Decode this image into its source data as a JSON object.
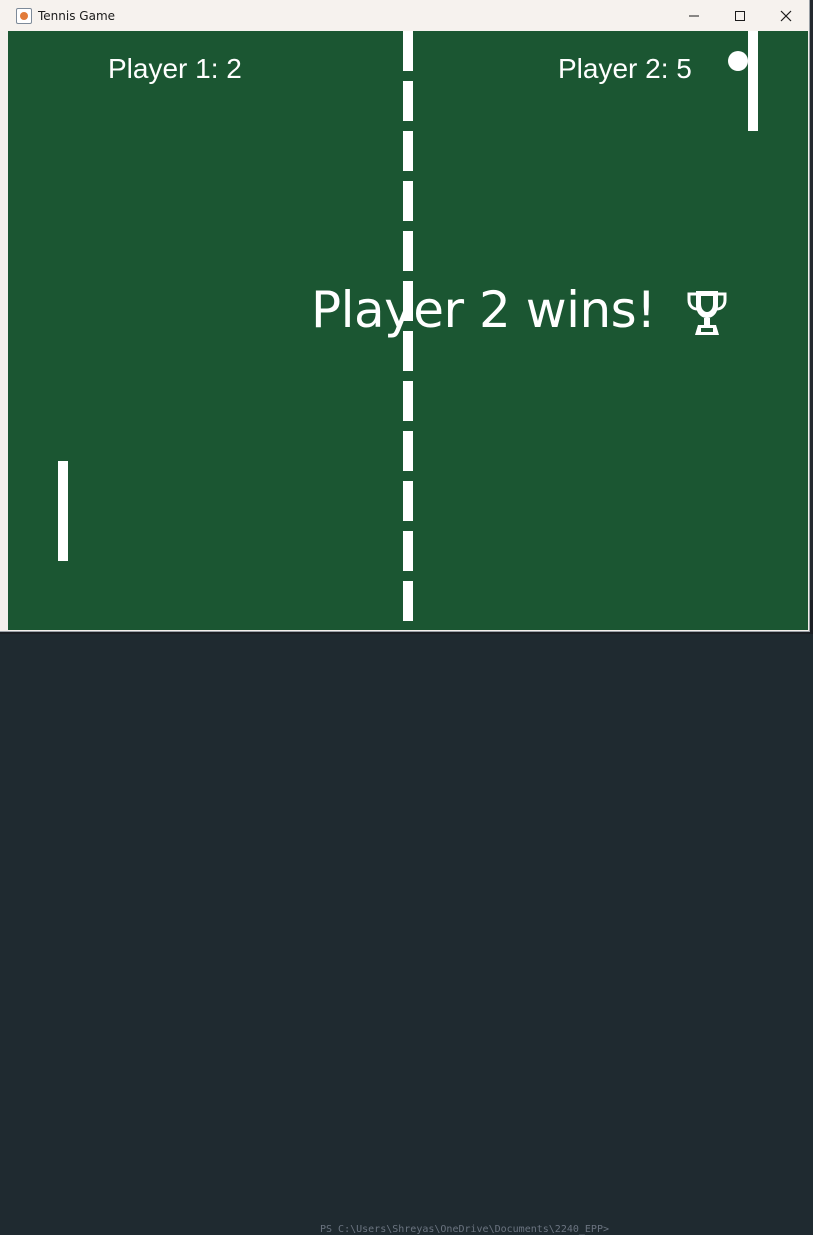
{
  "window": {
    "title": "Tennis Game",
    "icon": "java-app-icon",
    "controls": [
      "minimize-icon",
      "maximize-icon",
      "close-icon"
    ]
  },
  "game": {
    "player1_score_text": "Player 1: 2",
    "player2_score_text": "Player 2: 5",
    "winner_text": "Player 2 wins!",
    "winner_icon": "trophy-icon",
    "player1": {
      "name": "Player 1",
      "score": 2
    },
    "player2": {
      "name": "Player 2",
      "score": 5
    },
    "winner": "Player 2"
  },
  "background_terminal": {
    "partial_text": "PS C:\\Users\\Shreyas\\OneDrive\\Documents\\2240_EPP>"
  },
  "colors": {
    "court": "#1b5632",
    "lines": "#ffffff",
    "titlebar": "#f6f2ee"
  }
}
